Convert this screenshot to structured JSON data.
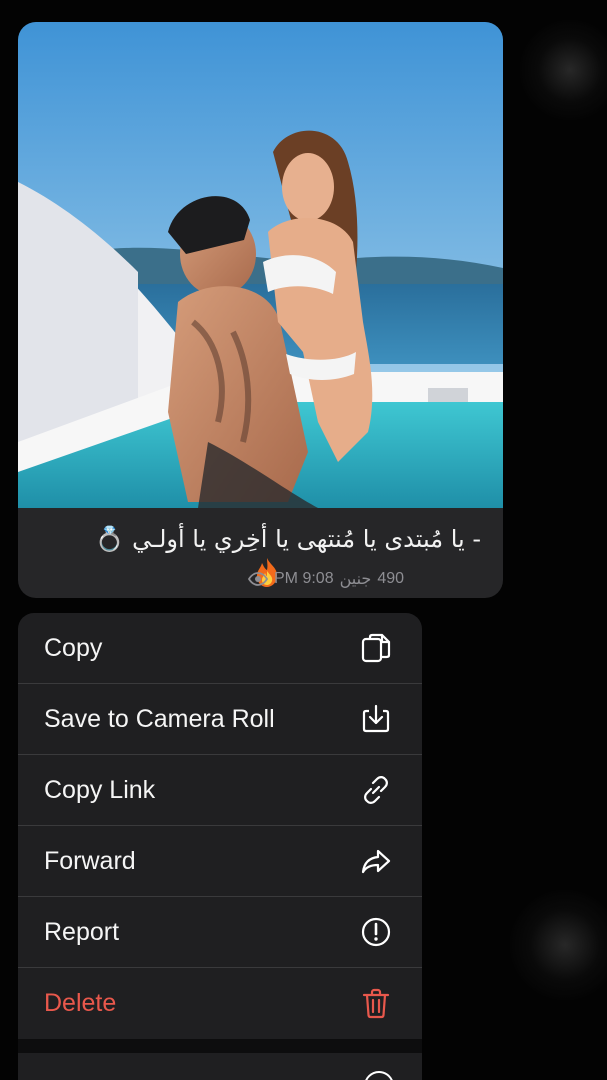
{
  "message": {
    "caption": "- يا مُبتدى يا مُنتهى يا أخِري يا أولـي 💍",
    "fire_emoji": "🔥",
    "views": "490",
    "date": "جنين",
    "time": "PM 9:08",
    "photo_icon": "photo-couple-pool"
  },
  "menu": {
    "items": [
      {
        "label": "Copy",
        "icon": "copy-icon"
      },
      {
        "label": "Save to Camera Roll",
        "icon": "save-to-camera-roll-icon"
      },
      {
        "label": "Copy Link",
        "icon": "link-icon"
      },
      {
        "label": "Forward",
        "icon": "forward-icon"
      },
      {
        "label": "Report",
        "icon": "report-icon"
      },
      {
        "label": "Delete",
        "icon": "trash-icon"
      }
    ]
  },
  "colors": {
    "background": "#030303",
    "bubble": "#262628",
    "menu": "#1f1f21",
    "danger": "#e8584c",
    "meta": "#8e8e93"
  }
}
